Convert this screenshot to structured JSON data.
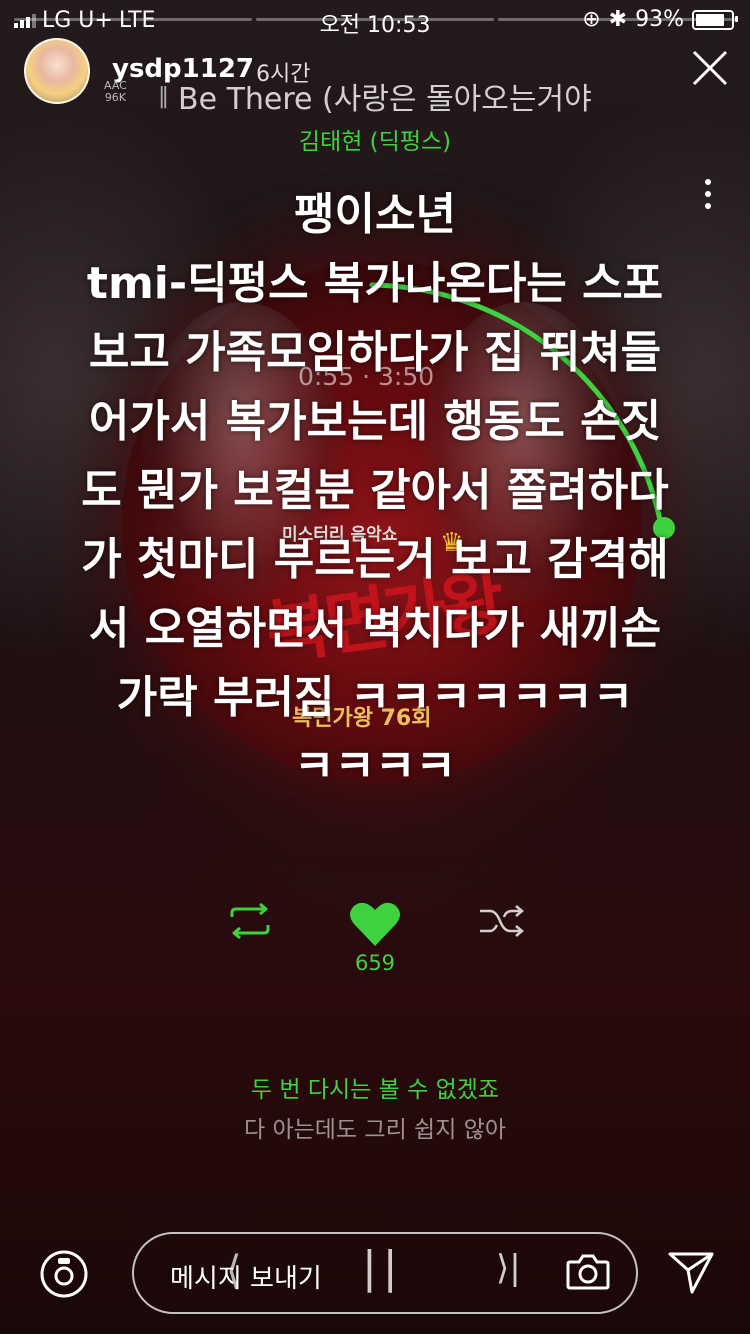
{
  "status_bar": {
    "carrier": "LG U+",
    "network": "LTE",
    "time": "오전 10:53",
    "battery": "93%",
    "battery_level": 0.93
  },
  "story": {
    "segments": 6,
    "username": "ysdp1127",
    "age": "6시간"
  },
  "player": {
    "codec": "AAC",
    "bitrate": "96K",
    "song_title": "Be There (사랑은 돌아오는거야",
    "artist": "김태현 (딕펑스)",
    "elapsed": "0:55",
    "separator": "·",
    "duration": "3:50",
    "progress": 0.239,
    "like_count": "659",
    "lyric_current": "두 번 다시는 볼 수 없겠죠",
    "lyric_next": "다 아는데도 그리 쉽지 않아",
    "accent_color": "#3fd13f"
  },
  "album_art": {
    "subtitle": "미스터리 음악쇼",
    "title": "복면가왕",
    "episode": "복면가왕 76회"
  },
  "overlay_text": {
    "lines": [
      "팽이소년",
      "tmi-딕펑스 복가나온다는 스포",
      "보고 가족모임하다가 집 뛰쳐들",
      "어가서 복가보는데 행동도 손짓",
      "도 뭔가 보컬분 같아서 쫄려하다",
      "가 첫마디 부르는거 보고 감격해",
      "서 오열하면서 벽치다가 새끼손",
      "가락 부러짐 ㅋㅋㅋㅋㅋㅋㅋ",
      "ㅋㅋㅋㅋ"
    ]
  },
  "bottom_bar": {
    "message_placeholder": "메시지 보내기"
  },
  "icons": {
    "close": "close-icon",
    "more": "more-vertical-icon",
    "repeat": "repeat-icon",
    "heart": "heart-icon",
    "shuffle": "shuffle-icon",
    "camera": "camera-icon",
    "send": "send-icon"
  }
}
